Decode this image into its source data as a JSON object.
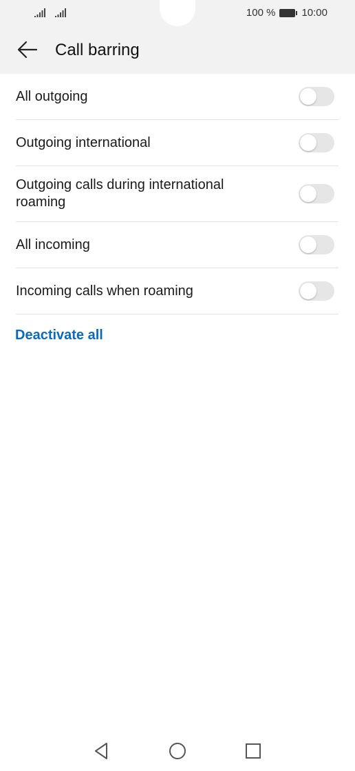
{
  "status_bar": {
    "battery_text": "100 %",
    "time": "10:00",
    "icons": [
      "signal-icon",
      "signal-icon",
      "battery-icon"
    ]
  },
  "app_bar": {
    "title": "Call barring",
    "back_icon": "arrow-left-icon"
  },
  "settings": [
    {
      "label": "All outgoing",
      "enabled": false
    },
    {
      "label": "Outgoing international",
      "enabled": false
    },
    {
      "label": "Outgoing calls during international roaming",
      "enabled": false
    },
    {
      "label": "All incoming",
      "enabled": false
    },
    {
      "label": "Incoming calls when roaming",
      "enabled": false
    }
  ],
  "deactivate_all_label": "Deactivate all",
  "colors": {
    "accent": "#0a6bb8",
    "header_bg": "#f2f2f2",
    "toggle_off": "#e6e6e6"
  },
  "nav_bar": {
    "icons": [
      "back-triangle-icon",
      "home-circle-icon",
      "recents-square-icon"
    ]
  }
}
